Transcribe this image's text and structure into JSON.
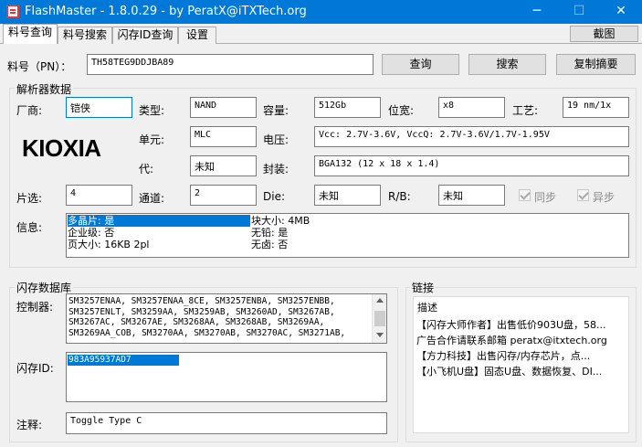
{
  "window": {
    "title": "FlashMaster - 1.8.0.29 - by PeratX@iTXTech.org",
    "minimize": "─",
    "maximize": "☐",
    "close": "✕"
  },
  "tabs": [
    "料号查询",
    "料号搜索",
    "闪存ID查询",
    "设置"
  ],
  "screenshot_label": "截图",
  "part": {
    "label": "料号（PN）：",
    "value": "TH58TEG9DDJBA89"
  },
  "buttons": {
    "query": "查询",
    "search": "搜索",
    "copy": "复制摘要"
  },
  "decoder": {
    "title": "解析器数据",
    "vendor_label": "厂商:",
    "vendor": "铠侠",
    "type_label": "类型:",
    "type": "NAND",
    "capacity_label": "容量:",
    "capacity": "512Gb",
    "width_label": "位宽:",
    "width": "x8",
    "process_label": "工艺:",
    "process": "19 nm/1x",
    "logo": "KIOXIA",
    "cell_label": "单元:",
    "cell": "MLC",
    "voltage_label": "电压:",
    "voltage": "Vcc: 2.7V-3.6V, VccQ: 2.7V-3.6V/1.7V-1.95V",
    "gen_label": "代:",
    "gen": "未知",
    "package_label": "封装:",
    "package": "BGA132 (12 x 18 x 1.4)",
    "ce_label": "片选:",
    "ce": "4",
    "channel_label": "通道:",
    "channel": "2",
    "die_label": "Die:",
    "die": "未知",
    "rb_label": "R/B:",
    "rb": "未知",
    "sync_label": "同步",
    "async_label": "异步",
    "info_label": "信息:",
    "info": {
      "multi_plane": "多晶片: 是",
      "block_size": "块大小: 4MB",
      "enterprise": "企业级: 否",
      "lead_free": "无铅: 是",
      "page_size": "页大小: 16KB 2pl",
      "halogen_free": "无卤: 否"
    }
  },
  "flashdb": {
    "title": "闪存数据库",
    "controller_label": "控制器:",
    "controllers": [
      "SM3257ENAA, SM3257ENAA_8CE, SM3257ENBA, SM3257ENBB,",
      "SM3257ENLT, SM3259AA, SM3259AB, SM3260AD, SM3267AB,",
      "SM3267AC, SM3267AE, SM3268AA, SM3268AB, SM3269AA,",
      "SM3269AA_COB, SM3270AA, SM3270AB, SM3270AC, SM3271AB,"
    ],
    "flashid_label": "闪存ID:",
    "flashid": "983A95937AD7",
    "note_label": "注释:",
    "note": "Toggle Type C"
  },
  "links": {
    "title": "链接",
    "header": "描述",
    "items": [
      "【闪存大师作者】出售低价903U盘，58...",
      "广告合作请联系邮箱 peratx@itxtech.org",
      "【方力科技】出售闪存/内存芯片，点...",
      "【小飞机U盘】固态U盘、数据恢复、DI..."
    ]
  }
}
